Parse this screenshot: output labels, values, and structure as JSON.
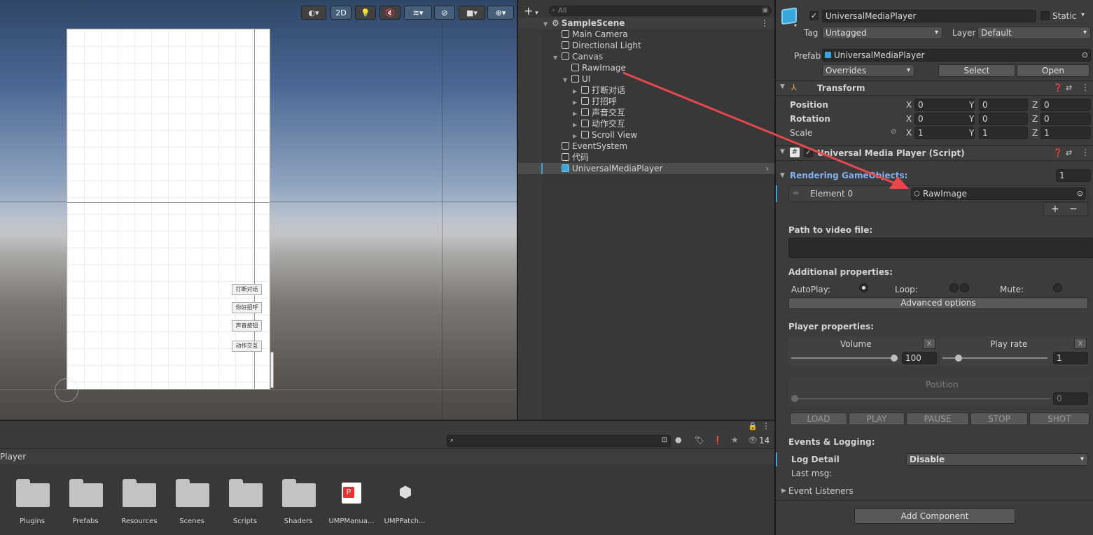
{
  "scene": {
    "toolbar": {
      "mode_2d": "2D"
    },
    "canvas_buttons": [
      "打断对话",
      "你好招呼",
      "声音按钮",
      "动作交互"
    ]
  },
  "hierarchy": {
    "search_placeholder": "All",
    "add_label": "+",
    "scene_name": "SampleScene",
    "items": [
      {
        "label": "Main Camera"
      },
      {
        "label": "Directional Light"
      },
      {
        "label": "Canvas"
      },
      {
        "label": "RawImage"
      },
      {
        "label": "UI"
      },
      {
        "label": "打断对话"
      },
      {
        "label": "打招呼"
      },
      {
        "label": "声音交互"
      },
      {
        "label": "动作交互"
      },
      {
        "label": "Scroll View"
      },
      {
        "label": "EventSystem"
      },
      {
        "label": "代码"
      },
      {
        "label": "UniversalMediaPlayer"
      }
    ]
  },
  "inspector": {
    "object_name": "UniversalMediaPlayer",
    "static_label": "Static",
    "tag_label": "Tag",
    "tag_value": "Untagged",
    "layer_label": "Layer",
    "layer_value": "Default",
    "prefab_label": "Prefab",
    "prefab_value": "UniversalMediaPlayer",
    "overrides_label": "Overrides",
    "select_label": "Select",
    "open_label": "Open",
    "transform": {
      "title": "Transform",
      "position_label": "Position",
      "rotation_label": "Rotation",
      "scale_label": "Scale",
      "position": [
        "0",
        "0",
        "0"
      ],
      "rotation": [
        "0",
        "0",
        "0"
      ],
      "scale": [
        "1",
        "1",
        "1"
      ],
      "axes": [
        "X",
        "Y",
        "Z"
      ]
    },
    "script": {
      "title": "Universal Media Player (Script)",
      "rendering_label": "Rendering GameObjects:",
      "rendering_count": "1",
      "element_label": "Element 0",
      "element_value": "RawImage",
      "plus": "+",
      "minus": "−",
      "path_label": "Path to video file:",
      "path_value": "",
      "additional_label": "Additional properties:",
      "autoplay_label": "AutoPlay:",
      "loop_label": "Loop:",
      "mute_label": "Mute:",
      "advanced_label": "Advanced options",
      "player_props_label": "Player properties:",
      "volume_label": "Volume",
      "volume_value": "100",
      "playrate_label": "Play rate",
      "playrate_value": "1",
      "x_label": "x",
      "position_label": "Position",
      "position_value": "0",
      "buttons": [
        "LOAD",
        "PLAY",
        "PAUSE",
        "STOP",
        "SHOT"
      ],
      "events_label": "Events & Logging:",
      "log_detail_label": "Log Detail",
      "log_detail_value": "Disable",
      "last_msg_label": "Last msg:",
      "event_listeners_label": "Event Listeners"
    },
    "add_component_label": "Add Component"
  },
  "project": {
    "breadcrumb": "Player",
    "count": "14",
    "items": [
      {
        "label": "Plugins",
        "type": "folder"
      },
      {
        "label": "Prefabs",
        "type": "folder"
      },
      {
        "label": "Resources",
        "type": "folder"
      },
      {
        "label": "Scenes",
        "type": "folder"
      },
      {
        "label": "Scripts",
        "type": "folder"
      },
      {
        "label": "Shaders",
        "type": "folder"
      },
      {
        "label": "UMPManua...",
        "type": "pdf"
      },
      {
        "label": "UMPPatch...",
        "type": "package"
      }
    ]
  },
  "colors": {
    "accent_blue": "#3aa7dc",
    "arrow_red": "#e8484a",
    "label_blue": "#7fb2f0"
  }
}
